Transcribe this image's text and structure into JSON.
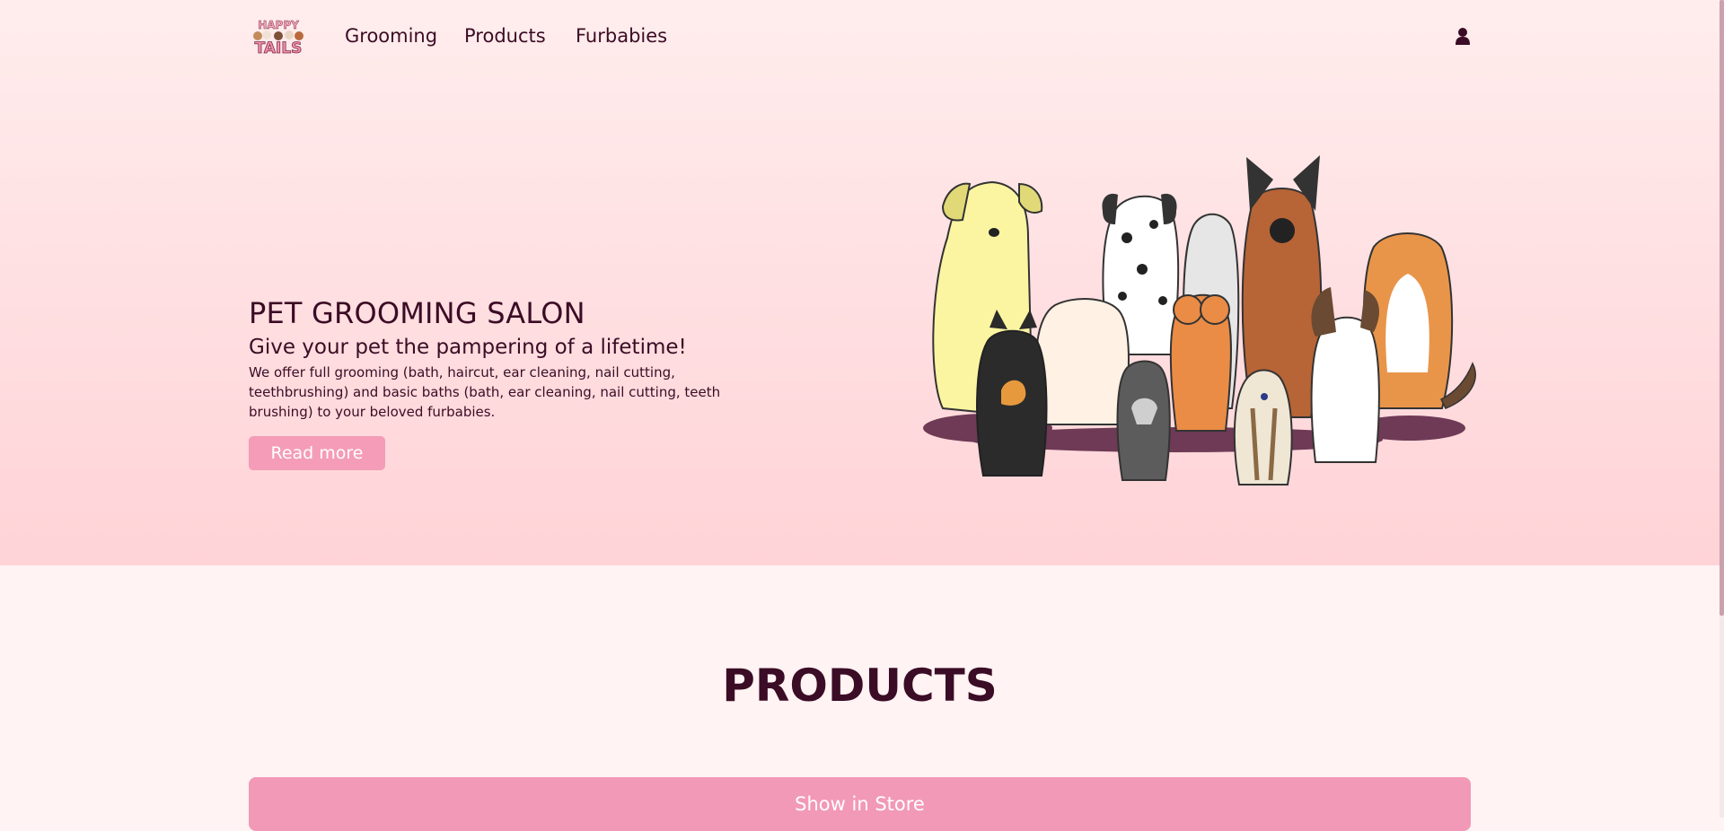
{
  "nav": {
    "logo_top_text": "HAPPY",
    "logo_bottom_text": "TAILS",
    "links": [
      "Grooming",
      "Products",
      "Furbabies"
    ],
    "user_icon": "user-icon"
  },
  "hero": {
    "title": "PET GROOMING SALON",
    "subtitle": "Give your pet the pampering of a lifetime!",
    "description": "We offer full grooming (bath, haircut, ear cleaning, nail cutting, teethbrushing) and basic baths (bath, ear cleaning, nail cutting, teeth brushing) to your beloved furbabies.",
    "button_label": "Read more",
    "illustration": "group-of-dogs-illustration"
  },
  "products": {
    "title": "PRODUCTS",
    "store_button_label": "Show in Store"
  },
  "colors": {
    "accent": "#f49cb8",
    "text": "#3b0c25",
    "hero_bg_top": "#ffeded",
    "hero_bg_bottom": "#ffd3d7",
    "page_bg": "#fff3f3"
  }
}
